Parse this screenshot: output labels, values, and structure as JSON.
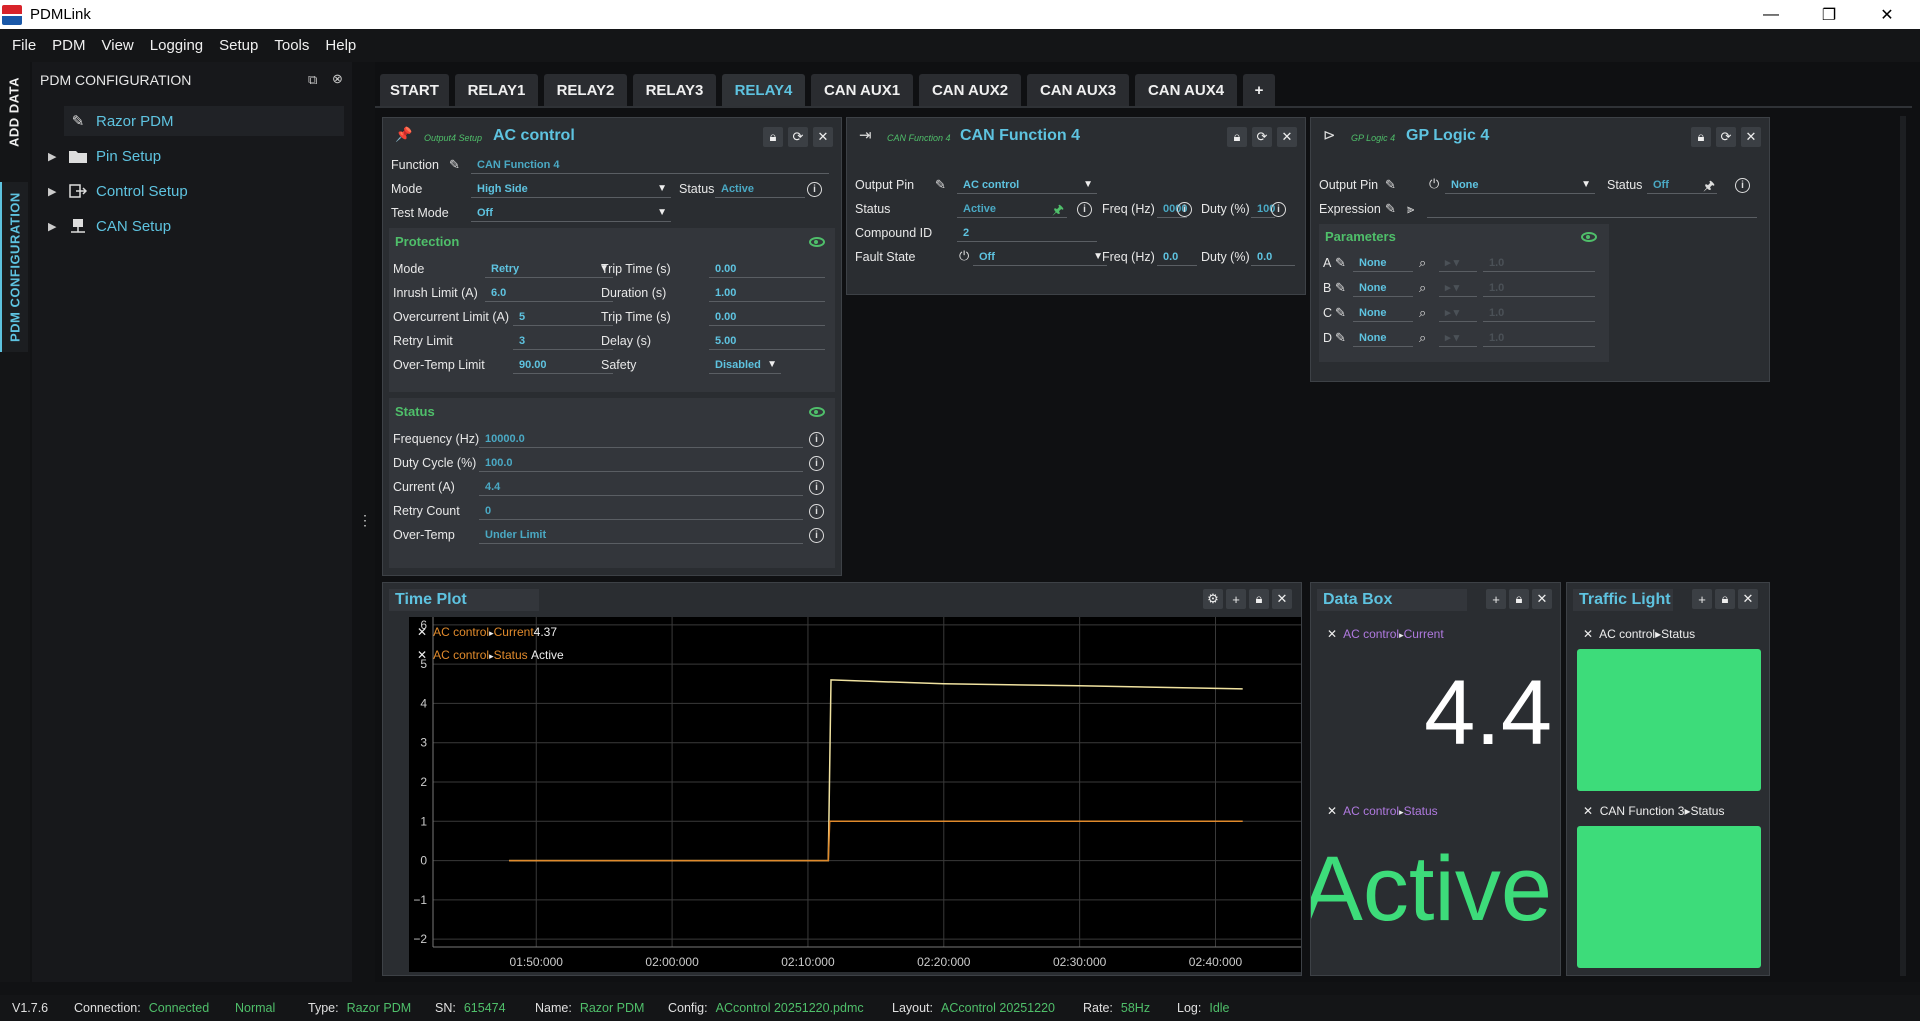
{
  "app": {
    "title": "PDMLink",
    "win_min": "—",
    "win_max": "❐",
    "win_close": "✕"
  },
  "menu": [
    "File",
    "PDM",
    "View",
    "Logging",
    "Setup",
    "Tools",
    "Help"
  ],
  "vtabs": {
    "add_data": "ADD DATA",
    "pdm_config": "PDM CONFIGURATION"
  },
  "left_panel": {
    "title": "PDM CONFIGURATION",
    "items": [
      {
        "label": "Razor PDM"
      },
      {
        "label": "Pin Setup"
      },
      {
        "label": "Control Setup"
      },
      {
        "label": "CAN Setup"
      }
    ]
  },
  "tabs": [
    "START",
    "RELAY1",
    "RELAY2",
    "RELAY3",
    "RELAY4",
    "CAN AUX1",
    "CAN AUX2",
    "CAN AUX3",
    "CAN AUX4",
    "+"
  ],
  "active_tab": "RELAY4",
  "output_panel": {
    "subtitle": "Output4 Setup",
    "title": "AC control",
    "function_label": "Function",
    "function_value": "CAN Function 4",
    "mode_label": "Mode",
    "mode_value": "High Side",
    "status_label": "Status",
    "status_value": "Active",
    "test_mode_label": "Test Mode",
    "test_mode_value": "Off",
    "protection": {
      "title": "Protection",
      "mode_label": "Mode",
      "mode_value": "Retry",
      "trip_time_label": "Trip Time (s)",
      "trip_time_value": "0.00",
      "inrush_label": "Inrush Limit (A)",
      "inrush_value": "6.0",
      "duration_label": "Duration (s)",
      "duration_value": "1.00",
      "overcurrent_label": "Overcurrent Limit (A)",
      "overcurrent_value": "5",
      "trip_time2_label": "Trip Time (s)",
      "trip_time2_value": "0.00",
      "retry_limit_label": "Retry Limit",
      "retry_limit_value": "3",
      "delay_label": "Delay (s)",
      "delay_value": "5.00",
      "overtemp_label": "Over-Temp Limit",
      "overtemp_value": "90.00",
      "safety_label": "Safety",
      "safety_value": "Disabled"
    },
    "status": {
      "title": "Status",
      "freq_label": "Frequency (Hz)",
      "freq_value": "10000.0",
      "duty_label": "Duty Cycle (%)",
      "duty_value": "100.0",
      "current_label": "Current (A)",
      "current_value": "4.4",
      "retry_count_label": "Retry Count",
      "retry_count_value": "0",
      "overtemp_label": "Over-Temp",
      "overtemp_value": "Under Limit"
    }
  },
  "can_panel": {
    "subtitle": "CAN Function 4",
    "title": "CAN Function 4",
    "output_pin_label": "Output Pin",
    "output_pin_value": "AC control",
    "status_label": "Status",
    "status_value": "Active",
    "freq_label": "Freq (Hz)",
    "freq_value": "0000",
    "duty_label": "Duty (%)",
    "duty_value": "100",
    "compound_label": "Compound ID",
    "compound_value": "2",
    "fault_label": "Fault State",
    "fault_value": "Off",
    "freq2_label": "Freq (Hz)",
    "freq2_value": "0.0",
    "duty2_label": "Duty (%)",
    "duty2_value": "0.0"
  },
  "logic_panel": {
    "subtitle": "GP Logic 4",
    "title": "GP Logic 4",
    "output_pin_label": "Output Pin",
    "output_pin_value": "None",
    "status_label": "Status",
    "status_value": "Off",
    "expression_label": "Expression",
    "params_title": "Parameters",
    "params": [
      {
        "key": "A",
        "value": "None",
        "num": "1.0"
      },
      {
        "key": "B",
        "value": "None",
        "num": "1.0"
      },
      {
        "key": "C",
        "value": "None",
        "num": "1.0"
      },
      {
        "key": "D",
        "value": "None",
        "num": "1.0"
      }
    ]
  },
  "time_plot": {
    "title": "Time Plot",
    "legend": [
      {
        "name": "AC control",
        "sep": "▸",
        "field": "Current",
        "value": "4.37"
      },
      {
        "name": "AC control",
        "sep": "▸",
        "field": "Status",
        "value": "Active"
      }
    ]
  },
  "chart_data": {
    "type": "line",
    "ylim": [
      -2.2,
      6.2
    ],
    "yticks": [
      "6",
      "5",
      "4",
      "3",
      "2",
      "1",
      "0",
      "−1",
      "−2"
    ],
    "xticks": [
      "01:50:000",
      "02:00:000",
      "02:10:000",
      "02:20:000",
      "02:30:000",
      "02:40:000"
    ],
    "series": [
      {
        "name": "AC control▸Current",
        "color": "#f0e2a0",
        "x": [
          "01:48:000",
          "02:11:500",
          "02:11:700",
          "02:20:000",
          "02:30:000",
          "02:42:000"
        ],
        "values": [
          0,
          0,
          4.6,
          4.5,
          4.45,
          4.37
        ]
      },
      {
        "name": "AC control▸Status",
        "color": "#e08a2c",
        "x": [
          "01:48:000",
          "02:11:500",
          "02:11:600",
          "02:42:000"
        ],
        "values": [
          0,
          0,
          1,
          1
        ]
      }
    ]
  },
  "data_box": {
    "title": "Data Box",
    "items": [
      {
        "name": "AC control",
        "sep": "▸",
        "field": "Current",
        "value": "4.4"
      },
      {
        "name": "AC control",
        "sep": "▸",
        "field": "Status",
        "value": "Active"
      }
    ]
  },
  "traffic_light": {
    "title": "Traffic Light",
    "items": [
      {
        "label": "AC control▸Status",
        "color": "#3ddc7a"
      },
      {
        "label": "CAN Function 3▸Status",
        "color": "#3ddc7a"
      }
    ]
  },
  "statusbar": {
    "version": "V1.7.6",
    "connection_label": "Connection:",
    "connection_value": "Connected",
    "mode_value": "Normal",
    "type_label": "Type:",
    "type_value": "Razor PDM",
    "sn_label": "SN:",
    "sn_value": "615474",
    "name_label": "Name:",
    "name_value": "Razor PDM",
    "config_label": "Config:",
    "config_value": "ACcontrol 20251220.pdmc",
    "layout_label": "Layout:",
    "layout_value": "ACcontrol 20251220",
    "rate_label": "Rate:",
    "rate_value": "58Hz",
    "log_label": "Log:",
    "log_value": "Idle"
  }
}
